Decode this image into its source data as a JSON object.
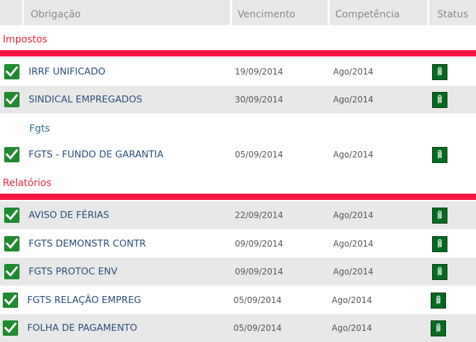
{
  "table": {
    "headers": {
      "obrigacao": "Obrigação",
      "vencimento": "Vencimento",
      "competencia": "Competência",
      "status": "Status"
    },
    "sections": [
      {
        "title": "Impostos",
        "rows": [
          {
            "name": "IRRF UNIFICADO",
            "vencimento": "19/09/2014",
            "competencia": "Ago/2014",
            "checked": true
          },
          {
            "name": "SINDICAL EMPREGADOS",
            "vencimento": "30/09/2014",
            "competencia": "Ago/2014",
            "checked": true
          }
        ],
        "subsections": [
          {
            "title": "Fgts",
            "rows": [
              {
                "name": "FGTS - FUNDO DE GARANTIA",
                "vencimento": "05/09/2014",
                "competencia": "Ago/2014",
                "checked": true
              }
            ]
          }
        ]
      },
      {
        "title": "Relatórios",
        "rows": [
          {
            "name": "AVISO DE FÉRIAS",
            "vencimento": "22/09/2014",
            "competencia": "Ago/2014",
            "checked": true
          },
          {
            "name": "FGTS DEMONSTR CONTR",
            "vencimento": "09/09/2014",
            "competencia": "Ago/2014",
            "checked": true
          },
          {
            "name": "FGTS PROTOC ENV",
            "vencimento": "09/09/2014",
            "competencia": "Ago/2014",
            "checked": true
          },
          {
            "name": "FGTS RELAÇÃO EMPREG",
            "vencimento": "05/09/2014",
            "competencia": "Ago/2014",
            "checked": true
          },
          {
            "name": "FOLHA DE PAGAMENTO",
            "vencimento": "05/09/2014",
            "competencia": "Ago/2014",
            "checked": true
          }
        ]
      }
    ]
  },
  "icons": {
    "checkbox": "check-icon",
    "status": "paperclip-icon"
  },
  "colors": {
    "section_title": "#e8283f",
    "section_bar": "#ff1744",
    "subsection_title": "#2e6f93",
    "row_text": "#2a4f7a",
    "checkbox_green": "#1f8a2e",
    "status_green": "#006b1f",
    "row_shade": "#e8e8e8"
  }
}
